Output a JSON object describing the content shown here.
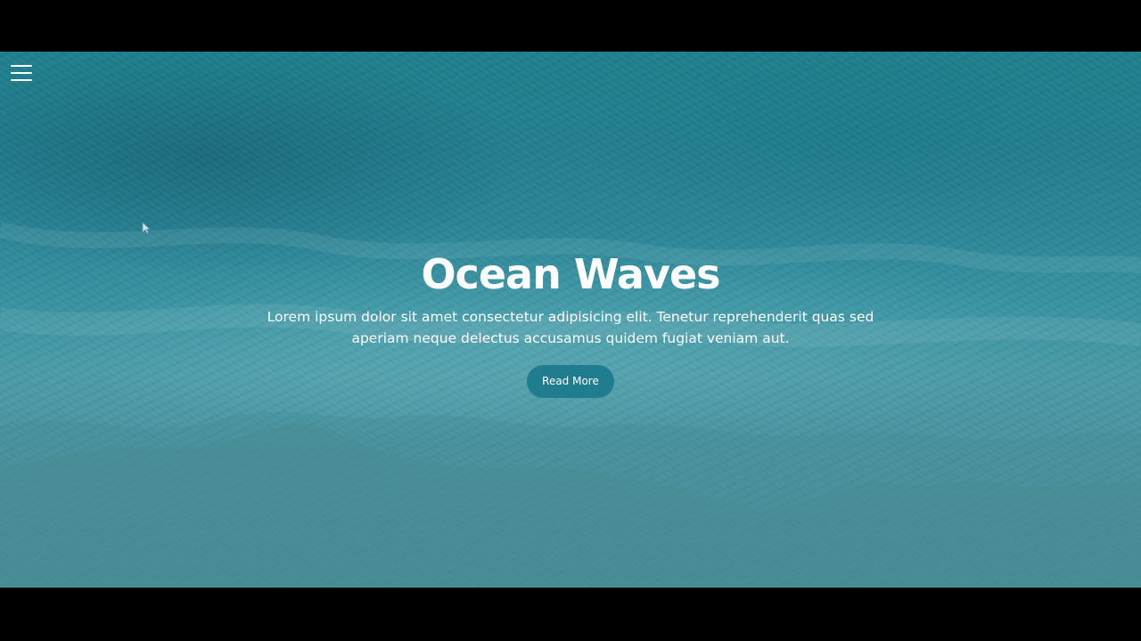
{
  "hero": {
    "title": "Ocean Waves",
    "description": "Lorem ipsum dolor sit amet consectetur adipisicing elit. Tenetur reprehenderit quas sed aperiam neque delectus accusamus quidem fugiat veniam aut.",
    "button_label": "Read More"
  },
  "nav": {
    "menu_icon": "hamburger-menu-icon"
  },
  "colors": {
    "background_top": "#1f7f8c",
    "background_bottom": "#4a8f9b",
    "button": "#1f7d8f",
    "text": "#ffffff",
    "letterbox": "#000000"
  }
}
